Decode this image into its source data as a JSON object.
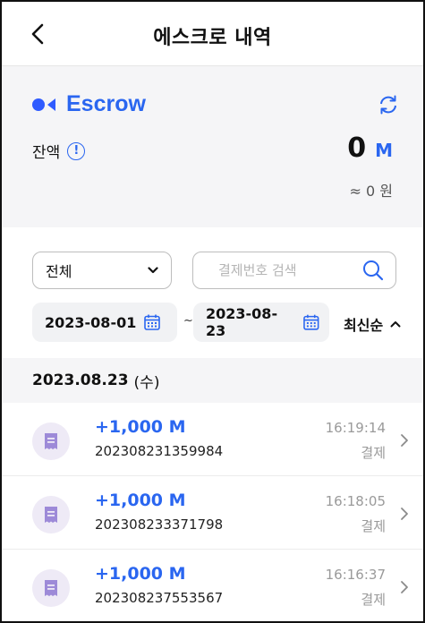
{
  "header": {
    "title": "에스크로 내역",
    "back_icon": "chevron-left-icon"
  },
  "balance": {
    "brand": "Escrow",
    "label": "잔액",
    "info_glyph": "!",
    "amount": "0",
    "unit": "M",
    "approx": "≈ 0 원",
    "refresh_icon": "refresh-icon"
  },
  "filters": {
    "type_select": {
      "value": "전체",
      "options": [
        "전체"
      ]
    },
    "search": {
      "value": "",
      "placeholder": "결제번호 검색"
    },
    "date_from": "2023-08-01",
    "date_to": "2023-08-23",
    "separator": "~",
    "sort_label": "최신순"
  },
  "list": {
    "date": "2023.08.23",
    "weekday": "(수)",
    "transactions": [
      {
        "amount": "+1,000 M",
        "id": "202308231359984",
        "time": "16:19:14",
        "type": "결제"
      },
      {
        "amount": "+1,000 M",
        "id": "202308233371798",
        "time": "16:18:05",
        "type": "결제"
      },
      {
        "amount": "+1,000 M",
        "id": "202308237553567",
        "time": "16:16:37",
        "type": "결제"
      }
    ]
  },
  "colors": {
    "accent": "#2a66f0",
    "icon_bg": "#eeeaf6",
    "icon_fg": "#9d8ad8",
    "section_bg": "#f5f5f7"
  }
}
